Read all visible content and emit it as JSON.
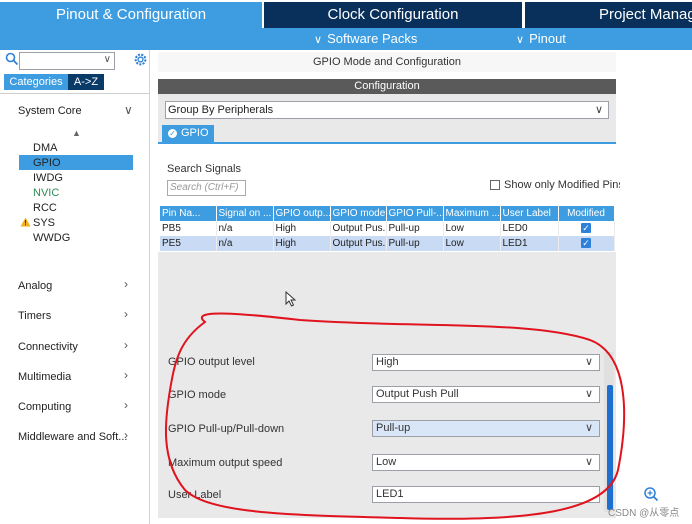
{
  "top_tabs": {
    "pinout": "Pinout & Configuration",
    "clock": "Clock Configuration",
    "project": "Project Manag"
  },
  "sub_menu": {
    "software_packs": "Software Packs",
    "pinout": "Pinout"
  },
  "left": {
    "search_value": "",
    "btn_categories": "Categories",
    "btn_az": "A->Z",
    "categories": [
      {
        "label": "System Core"
      },
      {
        "label": "Analog"
      },
      {
        "label": "Timers"
      },
      {
        "label": "Connectivity"
      },
      {
        "label": "Multimedia"
      },
      {
        "label": "Computing"
      },
      {
        "label": "Middleware and Soft..."
      }
    ],
    "system_core_items": [
      "DMA",
      "GPIO",
      "IWDG",
      "NVIC",
      "RCC",
      "SYS",
      "WWDG"
    ]
  },
  "center": {
    "mode_title": "GPIO Mode and Configuration",
    "config_bar": "Configuration",
    "group_by": "Group By Peripherals",
    "tab_gpio": "GPIO",
    "search_signals_label": "Search Signals",
    "search_placeholder": "Search (Ctrl+F)",
    "only_modified_label": "Show only Modified Pins"
  },
  "table": {
    "headers": [
      "Pin Na...",
      "Signal on ...",
      "GPIO outp...",
      "GPIO mode",
      "GPIO Pull-...",
      "Maximum ...",
      "User Label",
      "Modified"
    ],
    "rows": [
      [
        "PB5",
        "n/a",
        "High",
        "Output Pus...",
        "Pull-up",
        "Low",
        "LED0",
        true
      ],
      [
        "PE5",
        "n/a",
        "High",
        "Output Pus...",
        "Pull-up",
        "Low",
        "LED1",
        true
      ]
    ]
  },
  "detail": {
    "rows": [
      {
        "label": "GPIO output level",
        "value": "High"
      },
      {
        "label": "GPIO mode",
        "value": "Output Push Pull"
      },
      {
        "label": "GPIO Pull-up/Pull-down",
        "value": "Pull-up"
      },
      {
        "label": "Maximum output speed",
        "value": "Low"
      },
      {
        "label": "User Label",
        "value": "LED1"
      }
    ]
  },
  "watermark": "CSDN @从零点",
  "colors": {
    "accent": "#3d9de0",
    "dark_tab": "#08305a",
    "selection": "#c9daf5",
    "annotation": "#e0141e"
  }
}
